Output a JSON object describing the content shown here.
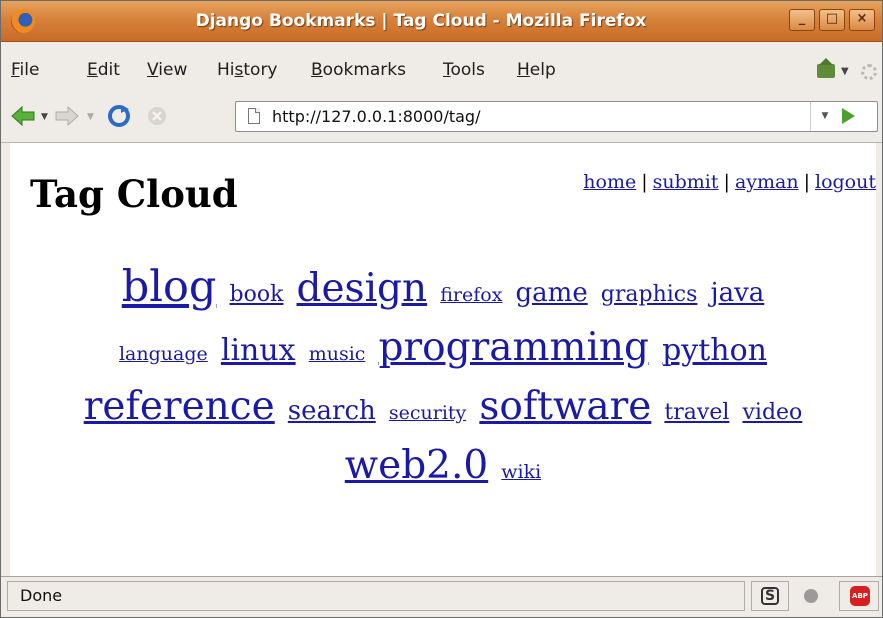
{
  "window": {
    "title": "Django Bookmarks | Tag Cloud - Mozilla Firefox"
  },
  "menubar": {
    "items": [
      {
        "pre": "",
        "u": "F",
        "post": "ile"
      },
      {
        "pre": "",
        "u": "E",
        "post": "dit"
      },
      {
        "pre": "",
        "u": "V",
        "post": "iew"
      },
      {
        "pre": "Hi",
        "u": "s",
        "post": "tory"
      },
      {
        "pre": "",
        "u": "B",
        "post": "ookmarks"
      },
      {
        "pre": "",
        "u": "T",
        "post": "ools"
      },
      {
        "pre": "",
        "u": "H",
        "post": "elp"
      }
    ]
  },
  "navbar": {
    "url": "http://127.0.0.1:8000/tag/"
  },
  "page": {
    "title": "Tag Cloud",
    "links": {
      "home": "home",
      "submit": "submit",
      "user": "ayman",
      "logout": "logout",
      "sep": "|"
    },
    "tags": [
      {
        "name": "blog",
        "size": 6
      },
      {
        "name": "book",
        "size": 2
      },
      {
        "name": "design",
        "size": 5
      },
      {
        "name": "firefox",
        "size": 1
      },
      {
        "name": "game",
        "size": 3
      },
      {
        "name": "graphics",
        "size": 2
      },
      {
        "name": "java",
        "size": 3
      },
      {
        "name": "language",
        "size": 1
      },
      {
        "name": "linux",
        "size": 4
      },
      {
        "name": "music",
        "size": 1
      },
      {
        "name": "programming",
        "size": 5
      },
      {
        "name": "python",
        "size": 4
      },
      {
        "name": "reference",
        "size": 5
      },
      {
        "name": "search",
        "size": 3
      },
      {
        "name": "security",
        "size": 1
      },
      {
        "name": "software",
        "size": 5
      },
      {
        "name": "travel",
        "size": 2
      },
      {
        "name": "video",
        "size": 2
      },
      {
        "name": "web2.0",
        "size": 5
      },
      {
        "name": "wiki",
        "size": 1
      }
    ]
  },
  "statusbar": {
    "text": "Done",
    "abp_label": "ABP",
    "s_label": "S"
  },
  "colors": {
    "link": "#1a1aa6",
    "titlebar": "#d7823c",
    "chrome": "#efebe7"
  }
}
